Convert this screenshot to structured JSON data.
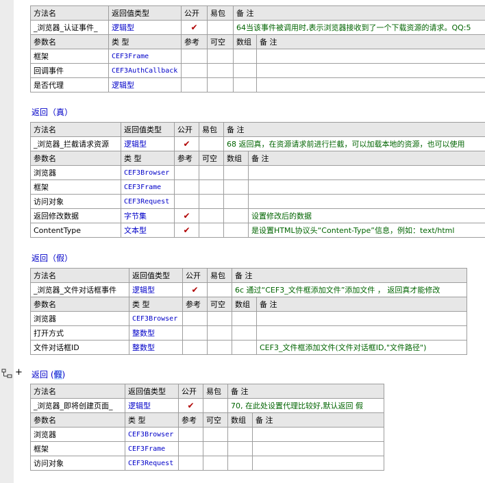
{
  "headers": {
    "method": [
      "方法名",
      "返回值类型",
      "公开",
      "易包",
      "备 注"
    ],
    "param": [
      "参数名",
      "类 型",
      "参考",
      "可空",
      "数组",
      "备 注"
    ]
  },
  "check": "✔",
  "blocks": [
    {
      "method": {
        "name": "_浏览器_认证事件_",
        "ret": "逻辑型",
        "public": true,
        "note": "64当该事件被调用时,表示浏览器接收到了一个下载资源的请求。QQ:5"
      },
      "params": [
        {
          "name": "框架",
          "type": "CEF3Frame",
          "ref": false,
          "note": ""
        },
        {
          "name": "回调事件",
          "type": "CEF3AuthCallback",
          "ref": false,
          "note": ""
        },
        {
          "name": "是否代理",
          "type": "逻辑型",
          "ref": false,
          "note": ""
        }
      ]
    },
    {
      "return_label": "返回（真）",
      "method": {
        "name": "_浏览器_拦截请求资源",
        "ret": "逻辑型",
        "public": true,
        "note": "68 返回真，在资源请求前进行拦截，可以加载本地的资源，也可以使用"
      },
      "params": [
        {
          "name": "浏览器",
          "type": "CEF3Browser",
          "ref": false,
          "note": ""
        },
        {
          "name": "框架",
          "type": "CEF3Frame",
          "ref": false,
          "note": ""
        },
        {
          "name": "访问对象",
          "type": "CEF3Request",
          "ref": false,
          "note": ""
        },
        {
          "name": "返回修改数据",
          "type": "字节集",
          "ref": true,
          "note": "设置修改后的数据"
        },
        {
          "name": "ContentType",
          "type": "文本型",
          "ref": true,
          "note": "是设置HTML协议头“Content-Type”信息，例如：text/html"
        }
      ]
    },
    {
      "return_label": "返回（假）",
      "method": {
        "name": "_浏览器_文件对话框事件",
        "ret": "逻辑型",
        "public": true,
        "note": "6c 通过“CEF3_文件框添加文件”添加文件 ， 返回真才能修改"
      },
      "params": [
        {
          "name": "浏览器",
          "type": "CEF3Browser",
          "ref": false,
          "note": ""
        },
        {
          "name": "打开方式",
          "type": "整数型",
          "ref": false,
          "note": ""
        },
        {
          "name": "文件对话框ID",
          "type": "整数型",
          "ref": false,
          "note": "CEF3_文件框添加文件(文件对话框ID,\"文件路径\")"
        }
      ]
    },
    {
      "return_label_prefix": "返回 (",
      "return_label_highlight": "假",
      "return_label_suffix": ")",
      "method": {
        "name": "_浏览器_即将创建页面_",
        "ret": "逻辑型",
        "public": true,
        "note": "70, 在此处设置代理比较好,默认返回 假"
      },
      "params": [
        {
          "name": "浏览器",
          "type": "CEF3Browser",
          "ref": false,
          "note": ""
        },
        {
          "name": "框架",
          "type": "CEF3Frame",
          "ref": false,
          "note": ""
        },
        {
          "name": "访问对象",
          "type": "CEF3Request",
          "ref": false,
          "note": ""
        }
      ]
    }
  ],
  "side_icons": {
    "tree": "tree-expand-icon",
    "plus": "+"
  }
}
